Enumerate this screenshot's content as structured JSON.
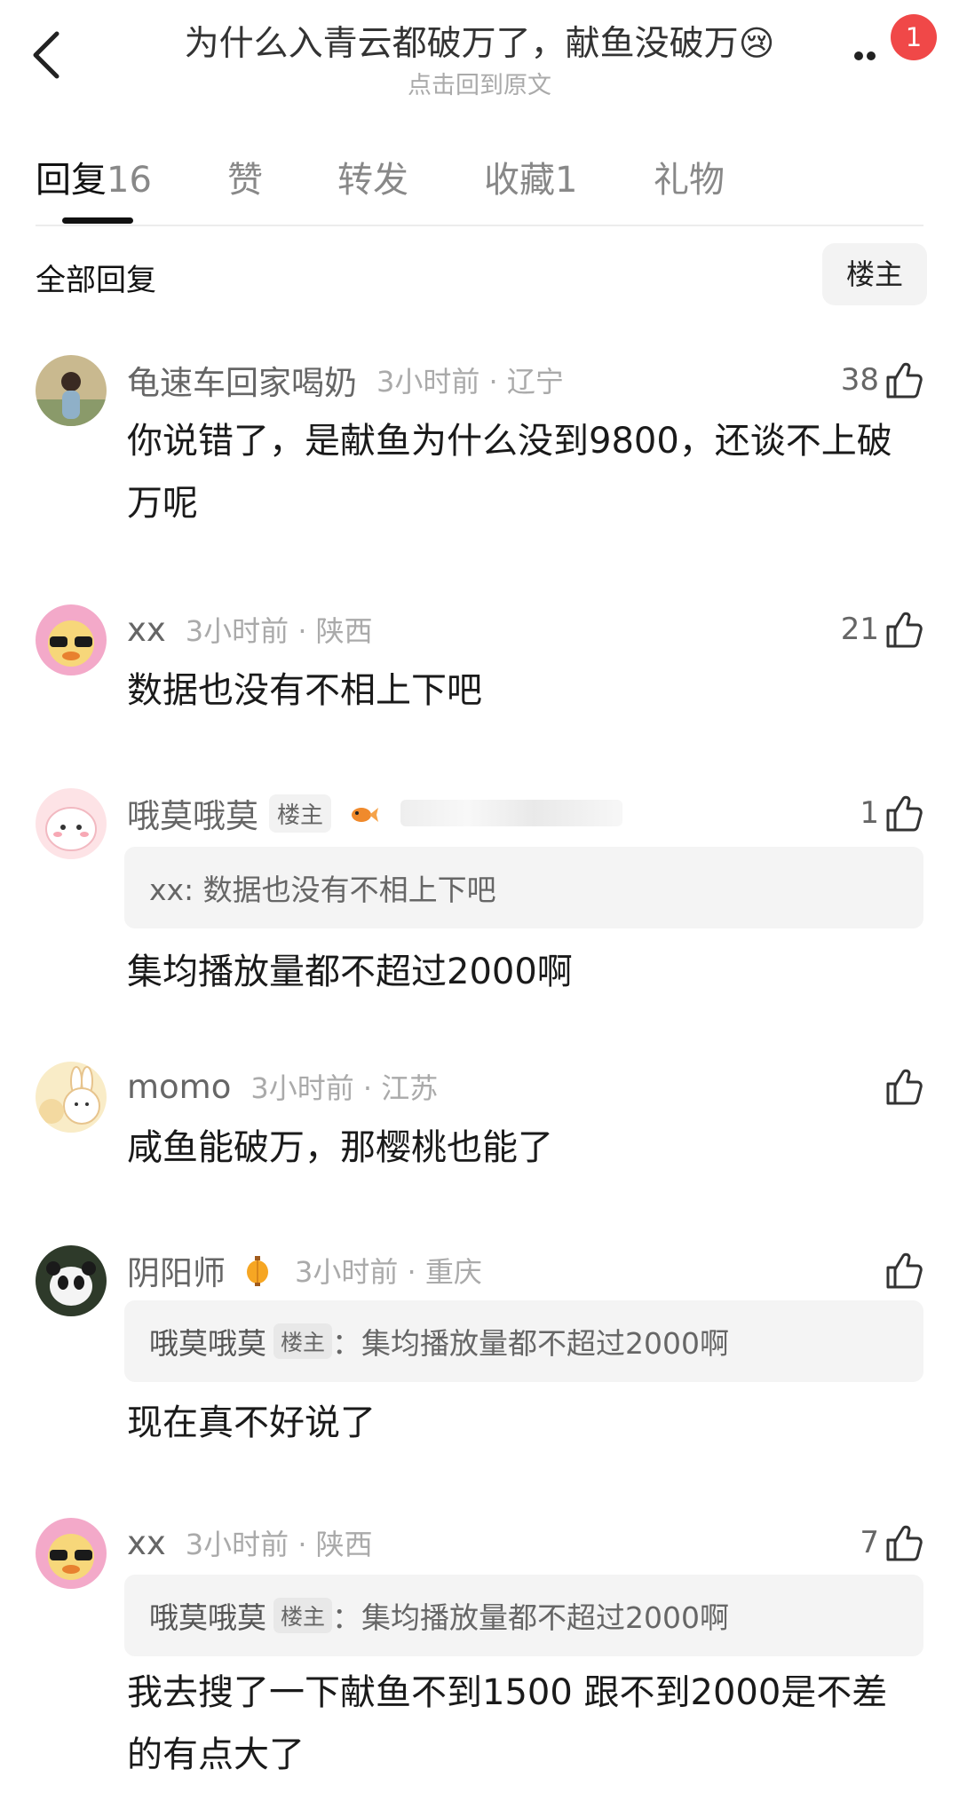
{
  "header": {
    "title": "为什么入青云都破万了，献鱼没破万",
    "title_emoji": "😢",
    "subtitle": "点击回到原文",
    "notification_count": "1"
  },
  "tabs": [
    {
      "label": "回复",
      "count": "16",
      "active": true
    },
    {
      "label": "赞",
      "count": ""
    },
    {
      "label": "转发",
      "count": ""
    },
    {
      "label": "收藏",
      "count": "1"
    },
    {
      "label": "礼物",
      "count": ""
    }
  ],
  "filter": {
    "all_label": "全部回复",
    "owner_label": "楼主"
  },
  "comments": [
    {
      "user": "龟速车回家喝奶",
      "time": "3小时前",
      "location": "辽宁",
      "time_loc": "3小时前 · 辽宁",
      "likes": "38",
      "text": "你说错了，是献鱼为什么没到9800，还谈不上破万呢"
    },
    {
      "user": "xx",
      "time": "3小时前",
      "location": "陕西",
      "time_loc": "3小时前 · 陕西",
      "likes": "21",
      "text": "数据也没有不相上下吧"
    },
    {
      "user": "哦莫哦莫",
      "owner_tag": "楼主",
      "badge_icon": "goldfish-icon",
      "likes": "1",
      "quote_user": "xx",
      "quote_text": "数据也没有不相上下吧",
      "quote_full": "xx: 数据也没有不相上下吧",
      "text": "集均播放量都不超过2000啊"
    },
    {
      "user": "momo",
      "time": "3小时前",
      "location": "江苏",
      "time_loc": "3小时前 · 江苏",
      "likes": "",
      "text": "咸鱼能破万，那樱桃也能了"
    },
    {
      "user": "阴阳师",
      "badge_icon": "lantern-icon",
      "time": "3小时前",
      "location": "重庆",
      "time_loc": "3小时前 · 重庆",
      "likes": "",
      "quote_user": "哦莫哦莫",
      "quote_tag": "楼主",
      "quote_text": "：集均播放量都不超过2000啊",
      "text": "现在真不好说了"
    },
    {
      "user": "xx",
      "time": "3小时前",
      "location": "陕西",
      "time_loc": "3小时前 · 陕西",
      "likes": "7",
      "quote_user": "哦莫哦莫",
      "quote_tag": "楼主",
      "quote_text": "：集均播放量都不超过2000啊",
      "text": "我去搜了一下献鱼不到1500 跟不到2000是不差的有点大了"
    }
  ],
  "colors": {
    "badge": "#f04848",
    "primary_text": "#1a1a1a",
    "secondary_text": "#666666",
    "muted_text": "#aaaaaa",
    "quote_bg": "#f4f4f4"
  }
}
